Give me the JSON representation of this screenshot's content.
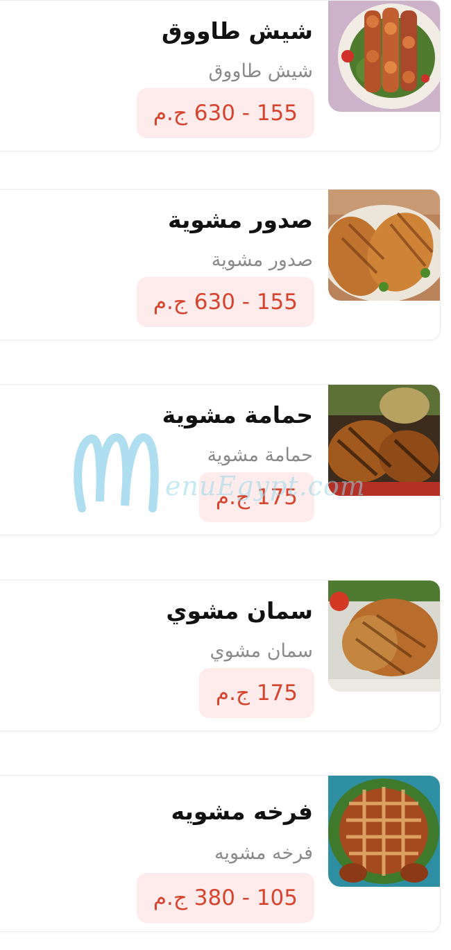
{
  "currency_suffix": "ج.م",
  "items": [
    {
      "title": "شيش طاووق",
      "subtitle": "شيش طاووق",
      "price": "155 - 630 ج.م",
      "photo": "shish-tawook-photo"
    },
    {
      "title": "صدور مشوية",
      "subtitle": "صدور مشوية",
      "price": "155 - 630 ج.م",
      "photo": "grilled-breasts-photo"
    },
    {
      "title": "حمامة مشوية",
      "subtitle": "حمامة مشوية",
      "price": "175 ج.م",
      "photo": "grilled-pigeon-photo"
    },
    {
      "title": "سمان مشوي",
      "subtitle": "سمان مشوي",
      "price": "175 ج.م",
      "photo": "grilled-quail-photo"
    },
    {
      "title": "فرخه مشويه",
      "subtitle": "فرخه مشويه",
      "price": "105 - 380 ج.م",
      "photo": "grilled-chicken-photo"
    }
  ],
  "watermark": {
    "text": "enuEgypt.com"
  },
  "colors": {
    "price_text": "#d4442e",
    "price_bg": "#fdeceb",
    "title": "#111111",
    "subtitle": "#8a8a8a",
    "watermark": "#96d7eb"
  }
}
